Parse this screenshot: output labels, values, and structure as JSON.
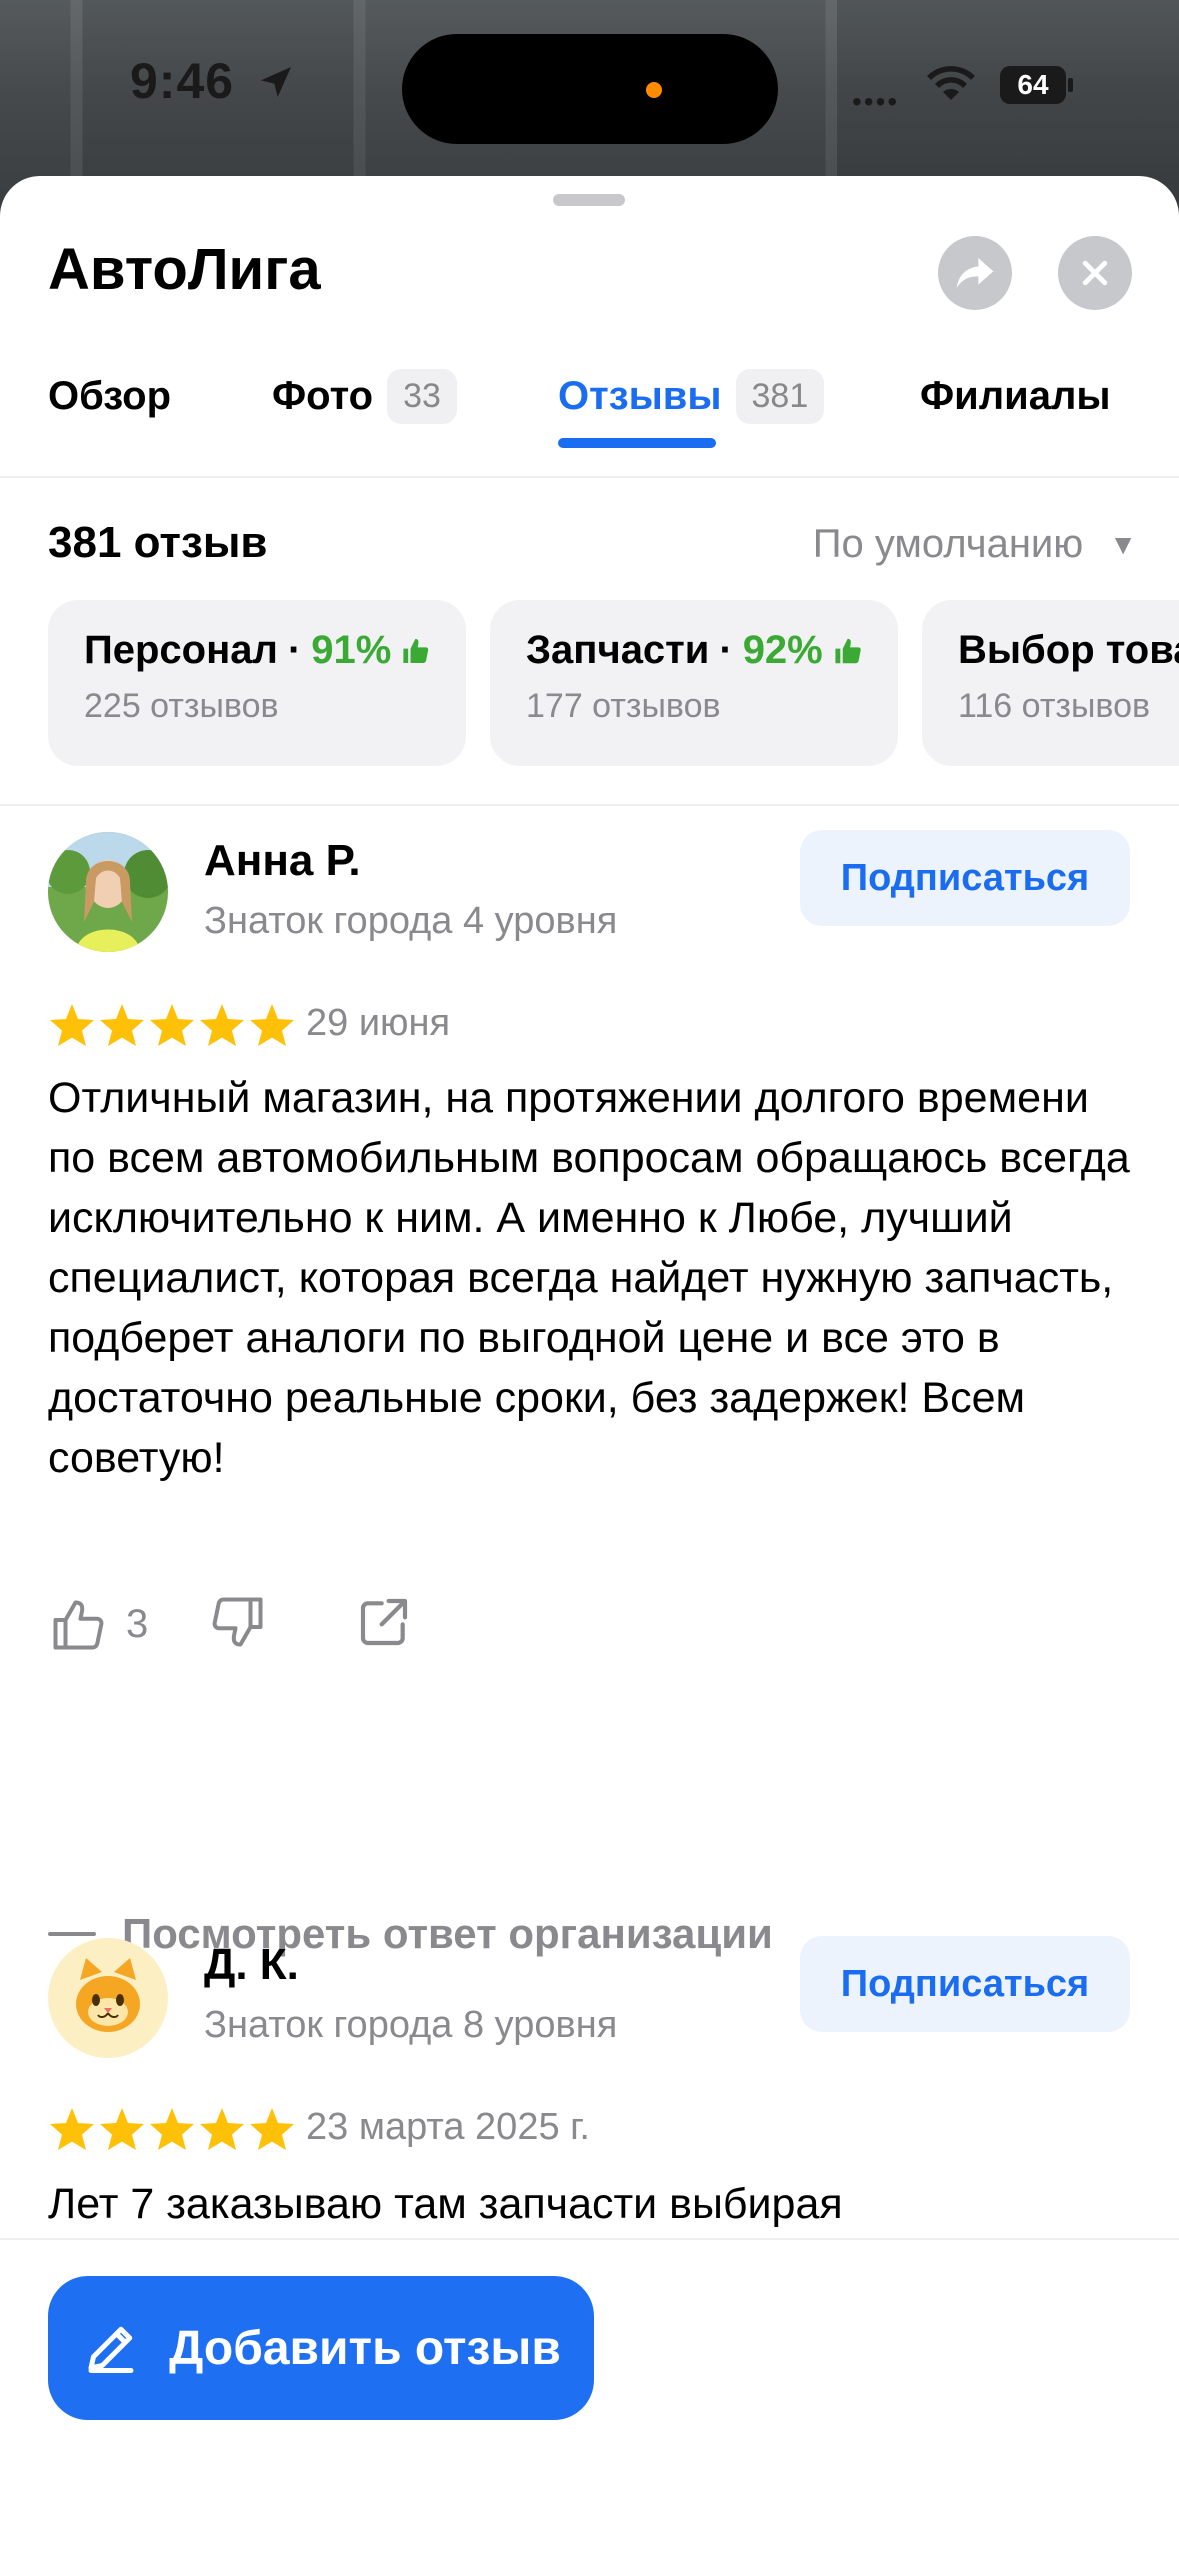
{
  "status_bar": {
    "time": "9:46",
    "battery": "64"
  },
  "header": {
    "title": "АвтоЛига"
  },
  "tabs": [
    {
      "label": "Обзор",
      "count": ""
    },
    {
      "label": "Фото",
      "count": "33"
    },
    {
      "label": "Отзывы",
      "count": "381"
    },
    {
      "label": "Филиалы",
      "count": ""
    }
  ],
  "summary": {
    "reviews_count": "381 отзыв",
    "sort_label": "По умолчанию"
  },
  "categories": [
    {
      "title": "Персонал",
      "dot": "·",
      "percent": "91%",
      "sub": "225 отзывов"
    },
    {
      "title": "Запчасти",
      "dot": "·",
      "percent": "92%",
      "sub": "177 отзывов"
    },
    {
      "title": "Выбор товаров",
      "dot": "·",
      "percent": "",
      "sub": "116 отзывов"
    }
  ],
  "reviews": [
    {
      "author": "Анна Р.",
      "level": "Знаток города 4 уровня",
      "subscribe": "Подписаться",
      "rating": 5,
      "date": "29 июня",
      "text": "Отличный магазин, на протяжении долгого времени по всем автомобильным вопросам обращаюсь всегда исключительно к ним. А именно к Любе, лучший специалист, которая всегда найдет нужную запчасть, подберет аналоги по выгодной цене и все это в достаточно реальные сроки, без задержек! Всем советую!",
      "likes": "3",
      "org_answer_link": "Посмотреть ответ организации"
    },
    {
      "author": "Д. К.",
      "level": "Знаток города 8 уровня",
      "subscribe": "Подписаться",
      "rating": 5,
      "date": "23 марта 2025 г.",
      "text": "Лет 7 заказываю там запчасти выбирая"
    }
  ],
  "bottom": {
    "add_review": "Добавить отзыв"
  },
  "colors": {
    "accent": "#1a6cf0",
    "button": "#1f6ff2",
    "positive": "#3aaa35",
    "star": "#ffc107"
  }
}
